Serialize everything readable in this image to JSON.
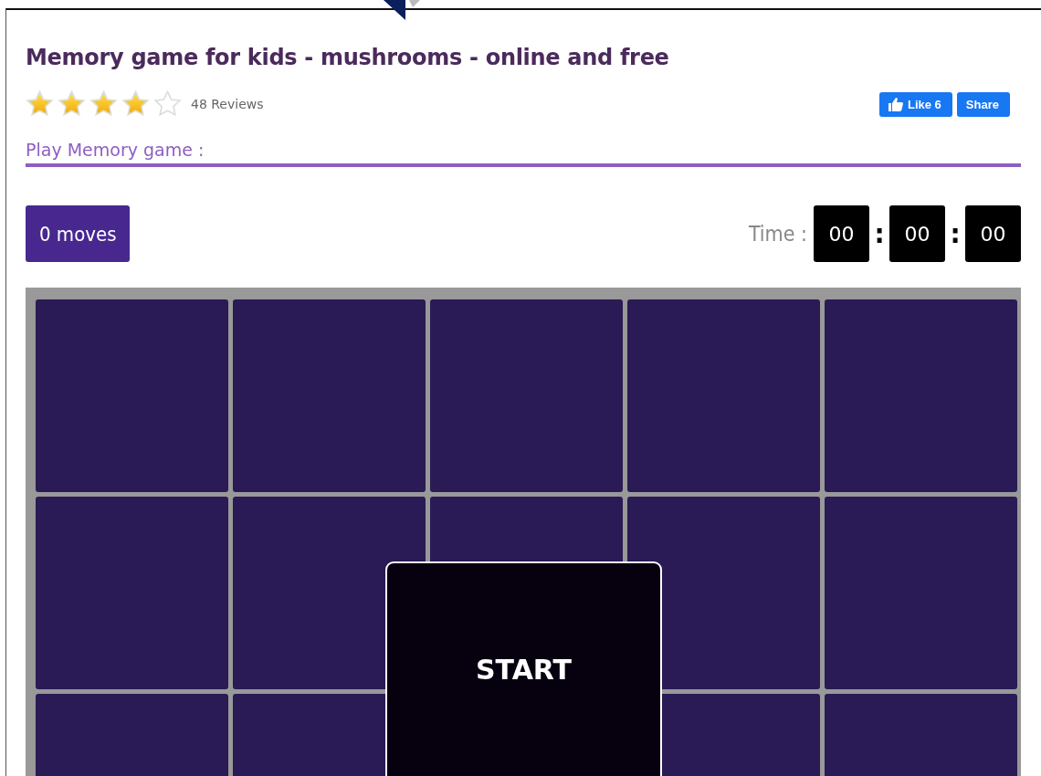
{
  "title": "Memory game for kids - mushrooms - online and free",
  "rating": {
    "stars": 4,
    "reviews": "48 Reviews"
  },
  "social": {
    "like": "Like 6",
    "share": "Share"
  },
  "section_heading": "Play Memory game :",
  "moves": "0 moves",
  "timer": {
    "label": "Time :",
    "separator": ":",
    "hours": "00",
    "minutes": "00",
    "seconds": "00"
  },
  "board": {
    "cards": [
      {
        "flipped": false
      },
      {
        "flipped": false
      },
      {
        "flipped": false
      },
      {
        "flipped": false
      },
      {
        "flipped": false
      },
      {
        "flipped": false
      },
      {
        "flipped": false
      },
      {
        "flipped": false
      },
      {
        "flipped": false
      },
      {
        "flipped": false
      },
      {
        "flipped": false
      },
      {
        "flipped": false
      },
      {
        "flipped": false
      },
      {
        "flipped": false
      }
    ],
    "start": "START"
  }
}
